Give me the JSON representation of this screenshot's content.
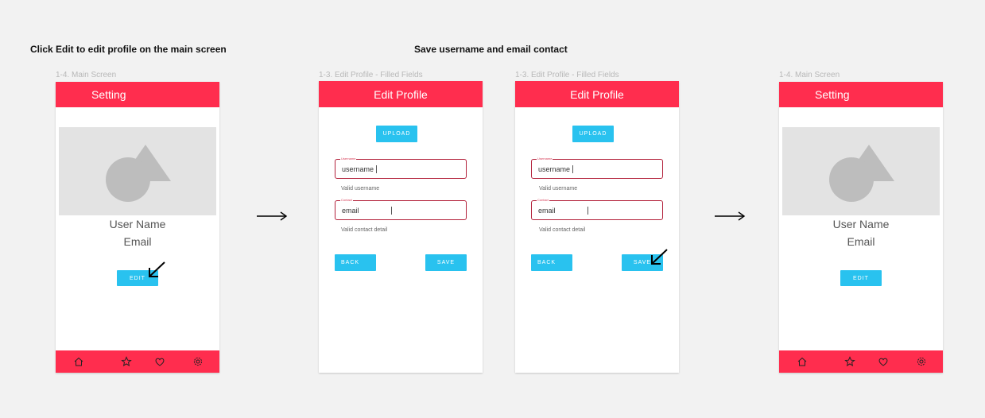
{
  "captions": {
    "left": "Click Edit to edit profile on the main screen",
    "middle": "Save username and email contact"
  },
  "frame_labels": {
    "f1": "1-4. Main Screen",
    "f2": "1-3. Edit Profile - Filled Fields",
    "f3": "1-3. Edit Profile - Filled Fields",
    "f4": "1-4. Main Screen"
  },
  "main_screen": {
    "header_title": "Setting",
    "user_name": "User Name",
    "email": "Email",
    "edit_label": "EDIT",
    "nav_icons": [
      "home-icon",
      "star-icon",
      "heart-icon",
      "gear-icon"
    ]
  },
  "edit_profile": {
    "header_title": "Edit Profile",
    "upload_label": "UPLOAD",
    "username_field_label": "Username",
    "username_value": "username",
    "username_helper": "Valid username",
    "contact_field_label": "Contact",
    "contact_value": "email",
    "contact_helper": "Valid contact detail",
    "back_label": "BACK",
    "save_label": "SAVE"
  },
  "colors": {
    "accent": "#ff2d4e",
    "button": "#29c2ef",
    "field_border": "#b3213b",
    "background": "#f2f2f2"
  }
}
